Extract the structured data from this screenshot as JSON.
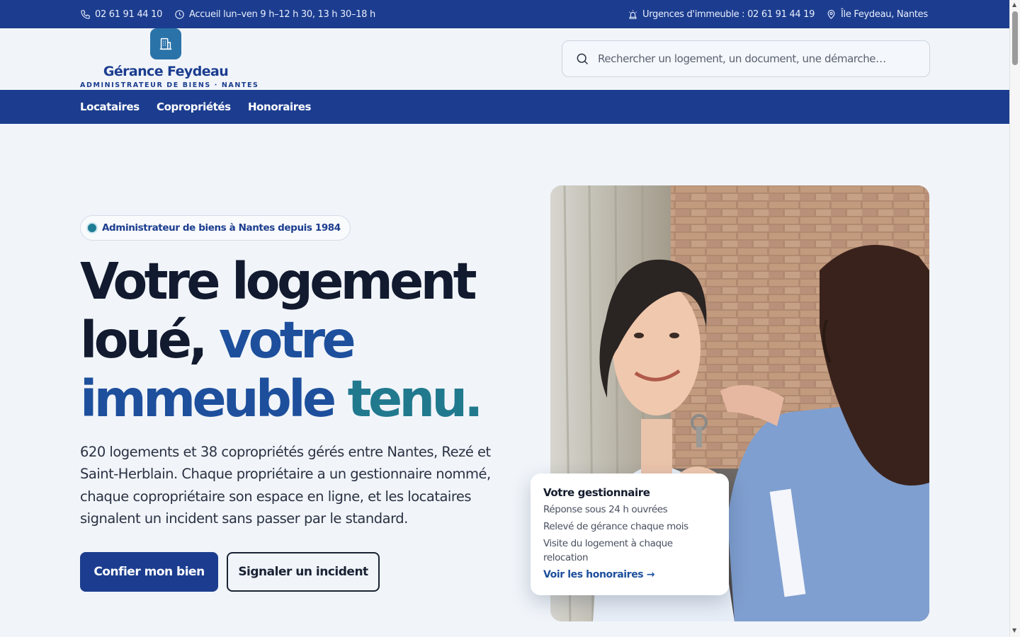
{
  "topbar": {
    "phone": "02 61 91 44 10",
    "hours": "Accueil lun–ven 9 h–12 h 30, 13 h 30–18 h",
    "emergency": "Urgences d'immeuble : 02 61 91 44 19",
    "location": "Île Feydeau, Nantes"
  },
  "brand": {
    "name": "Gérance Feydeau",
    "tagline": "ADMINISTRATEUR DE BIENS · NANTES",
    "color": "#1c3d8f"
  },
  "search": {
    "placeholder": "Rechercher un logement, un document, une démarche…"
  },
  "nav": {
    "items": [
      {
        "label": "Locataires"
      },
      {
        "label": "Copropriétés"
      },
      {
        "label": "Honoraires"
      }
    ]
  },
  "hero": {
    "badge": "Administrateur de biens à Nantes depuis 1984",
    "title_part1": "Votre logement loué,",
    "title_part2": "votre",
    "title_part3": "immeuble",
    "title_part4": "tenu.",
    "description": "620 logements et 38 copropriétés gérés entre Nantes, Rezé et Saint-Herblain. Chaque propriétaire a un gestionnaire nommé, chaque copropriétaire son espace en ligne, et les locataires signalent un incident sans passer par le standard.",
    "primary_button": "Confier mon bien",
    "secondary_button": "Signaler un incident"
  },
  "card": {
    "title": "Votre gestionnaire",
    "items": [
      "Réponse sous 24 h ouvrées",
      "Relevé de gérance chaque mois",
      "Visite du logement à chaque relocation"
    ],
    "link": "Voir les honoraires →"
  },
  "colors": {
    "primary": "#1c3d8f",
    "accent_blue": "#1d4f9c",
    "accent_teal": "#21798e",
    "background": "#f1f5fa"
  }
}
